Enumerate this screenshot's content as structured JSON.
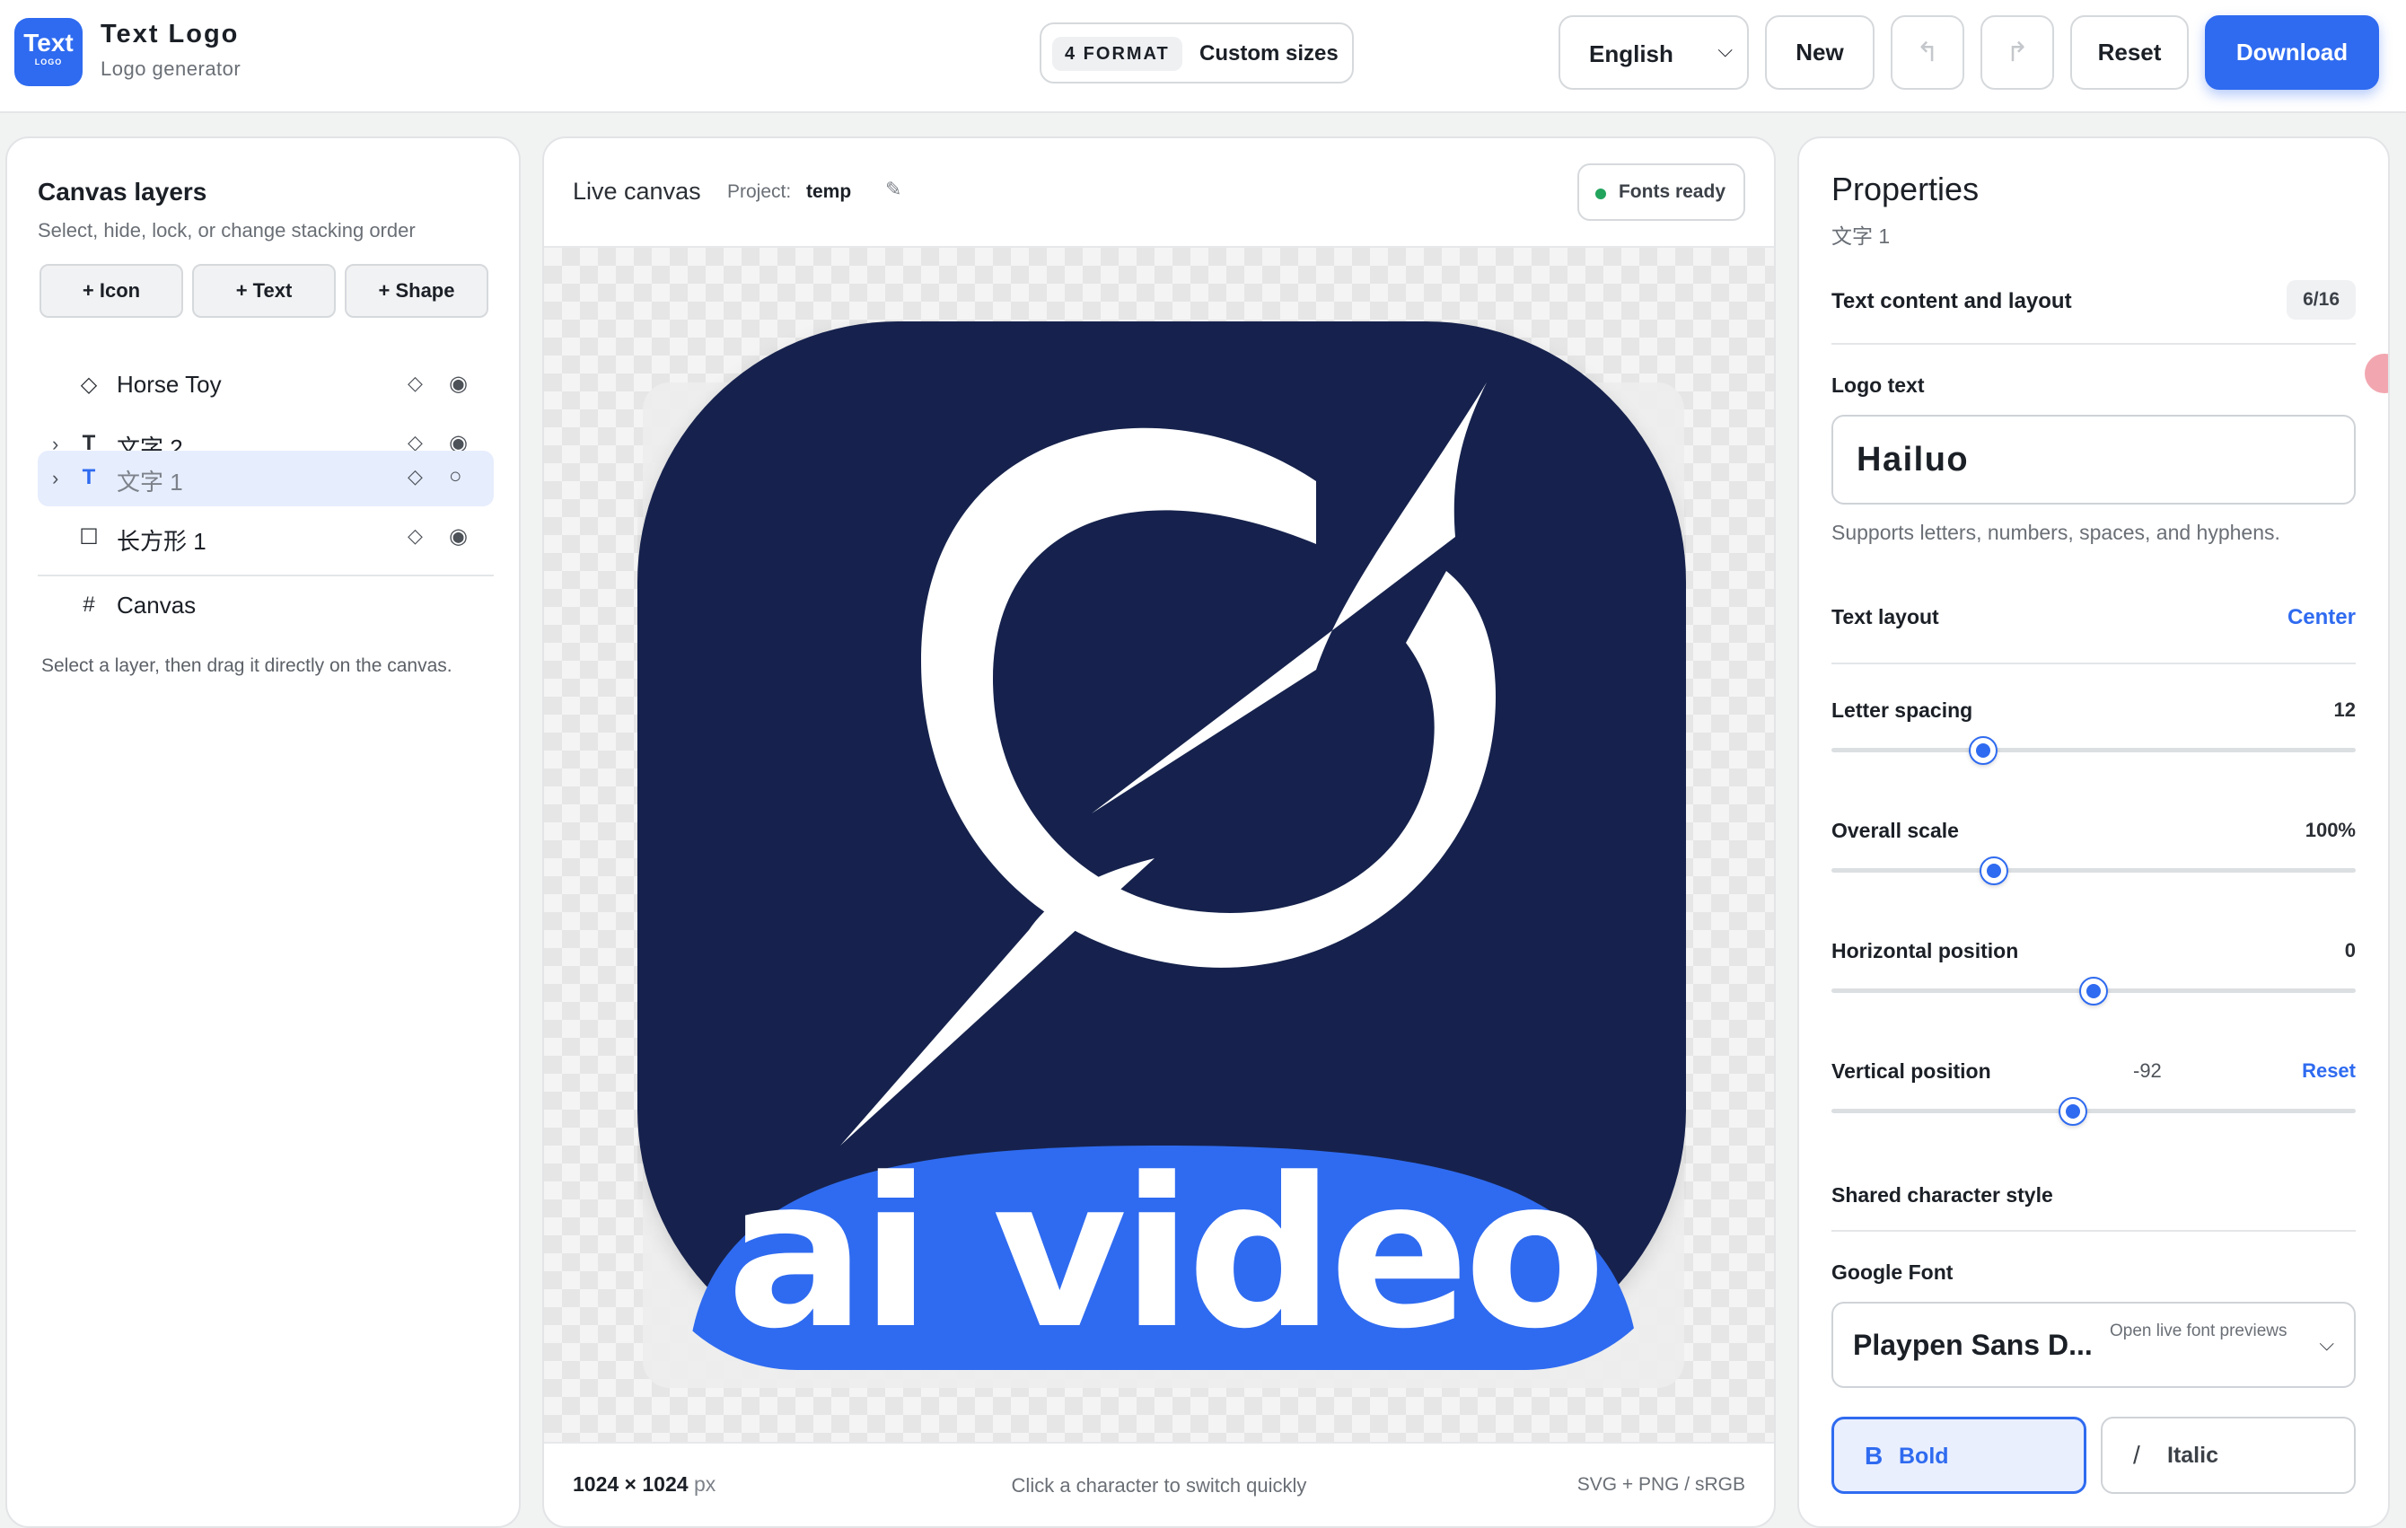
{
  "header": {
    "brand_big": "Text",
    "brand_small": "LOGO",
    "title": "Text Logo",
    "subtitle": "Logo generator",
    "format_badge": "4 FORMAT",
    "format_label": "Custom sizes",
    "language": "English",
    "new_label": "New",
    "undo_glyph": "↰",
    "redo_glyph": "↱",
    "reset_label": "Reset",
    "download_label": "Download"
  },
  "layers_panel": {
    "title": "Canvas layers",
    "subtitle": "Select, hide, lock, or change stacking order",
    "add_buttons": [
      "+ Icon",
      "+ Text",
      "+ Shape"
    ],
    "items": [
      {
        "chev": "",
        "type": "◇",
        "name": "Horse Toy",
        "lock": "◇",
        "vis": "◉"
      },
      {
        "chev": "›",
        "type": "T",
        "name": "文字 2",
        "lock": "◇",
        "vis": "◉"
      },
      {
        "chev": "›",
        "type": "T",
        "name": "文字 1",
        "lock": "◇",
        "vis": "○"
      },
      {
        "chev": "",
        "type": "☐",
        "name": "长方形 1",
        "lock": "◇",
        "vis": "◉"
      }
    ],
    "canvas_icon": "#",
    "canvas_label": "Canvas",
    "hint": "Select a layer, then drag it directly on the canvas."
  },
  "canvas": {
    "title": "Live canvas",
    "project_label": "Project:",
    "project_name": "temp",
    "pencil": "✎",
    "fonts_status": "Fonts ready",
    "logo_text": "ai video",
    "size_value": "1024 × 1024",
    "size_unit": "px",
    "hint": "Click a character to switch quickly",
    "formats": "SVG + PNG / sRGB",
    "colors": {
      "tile": "#19214d",
      "band": "#2f6bf0",
      "mark": "#ffffff"
    }
  },
  "properties": {
    "title": "Properties",
    "subtitle": "文字 1",
    "section_text": "Text content and layout",
    "count": "6/16",
    "logo_text_label": "Logo text",
    "logo_text_value": "Hailuo",
    "help": "Supports letters, numbers, spaces, and hyphens.",
    "text_layout_label": "Text layout",
    "text_layout_value": "Center",
    "letter_spacing": {
      "label": "Letter spacing",
      "value": "12",
      "fraction": 0.29
    },
    "overall_scale": {
      "label": "Overall scale",
      "value": "100%",
      "fraction": 0.31
    },
    "horizontal": {
      "label": "Horizontal position",
      "value": "0",
      "fraction": 0.5
    },
    "vertical": {
      "label": "Vertical position",
      "value": "-92",
      "reset": "Reset",
      "fraction": 0.46
    },
    "shared_style": "Shared character style",
    "google_font_label": "Google Font",
    "font_name": "Playpen Sans D...",
    "font_hint": "Open live font previews",
    "bold_glyph": "B",
    "bold_label": "Bold",
    "italic_glyph": "/",
    "italic_label": "Italic"
  }
}
